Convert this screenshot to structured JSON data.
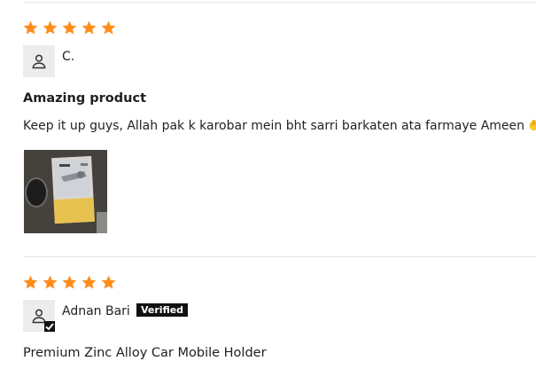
{
  "colors": {
    "star": "#ff8c1a",
    "divider": "#e6e6e6",
    "avatar_bg": "#ececec",
    "badge_bg": "#111111"
  },
  "reviews": [
    {
      "rating": 5,
      "reviewer": "C.",
      "verified": false,
      "title": "Amazing product",
      "body": "Keep it up guys, Allah pak k karobar mein bht sarri barkaten ata farmaye Ameen",
      "emoji": "🤲",
      "photo_icon": "review-photo"
    },
    {
      "rating": 5,
      "reviewer": "Adnan Bari",
      "verified": true,
      "verified_label": "Verified",
      "title": "Premium Zinc Alloy Car Mobile Holder"
    }
  ]
}
